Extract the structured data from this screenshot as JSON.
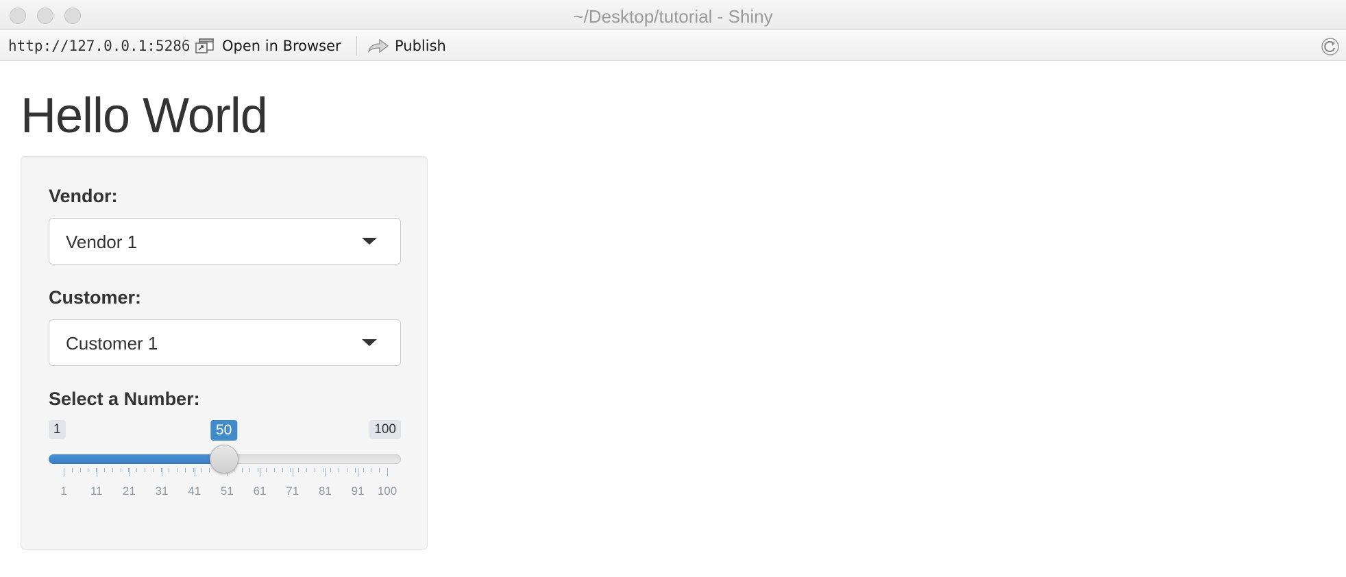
{
  "window": {
    "title": "~/Desktop/tutorial - Shiny"
  },
  "toolbar": {
    "url": "http://127.0.0.1:5286",
    "open_in_browser_label": "Open in Browser",
    "publish_label": "Publish"
  },
  "page": {
    "title": "Hello World"
  },
  "controls": {
    "vendor": {
      "label": "Vendor:",
      "value": "Vendor 1"
    },
    "customer": {
      "label": "Customer:",
      "value": "Customer 1"
    },
    "number": {
      "label": "Select a Number:",
      "min": 1,
      "max": 100,
      "value": 50,
      "min_label": "1",
      "max_label": "100",
      "value_label": "50",
      "tick_labels": [
        "1",
        "11",
        "21",
        "31",
        "41",
        "51",
        "61",
        "71",
        "81",
        "91",
        "100"
      ],
      "color": "#428bca"
    }
  }
}
